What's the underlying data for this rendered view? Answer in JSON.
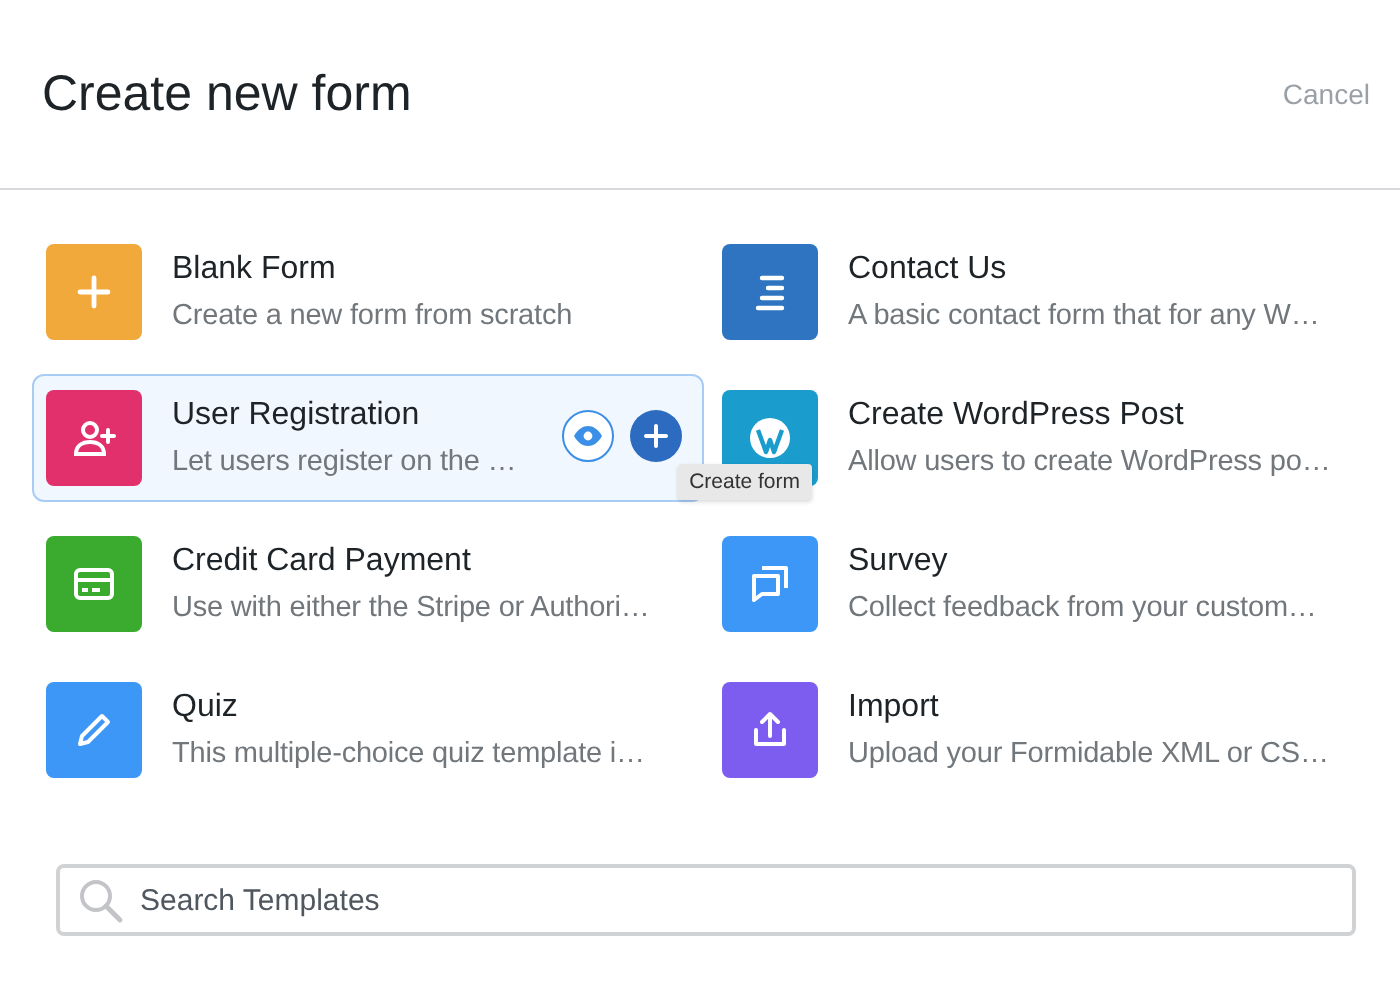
{
  "header": {
    "title": "Create new form",
    "cancel": "Cancel"
  },
  "templates": [
    {
      "name": "Blank Form",
      "description": "Create a new form from scratch",
      "kind": "plus",
      "color": "#f2a93b",
      "hovered": false
    },
    {
      "name": "Contact Us",
      "description": "A basic contact form that for any W…",
      "kind": "lines",
      "color": "#2f74c0",
      "hovered": false
    },
    {
      "name": "User Registration",
      "description": "Let users register on the …",
      "kind": "user-add",
      "color": "#e1306c",
      "hovered": true,
      "actions": {
        "tooltip": "Create form"
      }
    },
    {
      "name": "Create WordPress Post",
      "description": "Allow users to create WordPress po…",
      "kind": "wordpress",
      "color": "#1a9ccc",
      "hovered": false
    },
    {
      "name": "Credit Card Payment",
      "description": "Use with either the Stripe or Authori…",
      "kind": "card",
      "color": "#3aab2f",
      "hovered": false
    },
    {
      "name": "Survey",
      "description": "Collect feedback from your custom…",
      "kind": "chat",
      "color": "#3d97f6",
      "hovered": false
    },
    {
      "name": "Quiz",
      "description": "This multiple-choice quiz template i…",
      "kind": "pencil",
      "color": "#3d97f6",
      "hovered": false
    },
    {
      "name": "Import",
      "description": "Upload your Formidable XML or CS…",
      "kind": "upload",
      "color": "#7d5cf0",
      "hovered": false
    }
  ],
  "search": {
    "placeholder": "Search Templates"
  }
}
